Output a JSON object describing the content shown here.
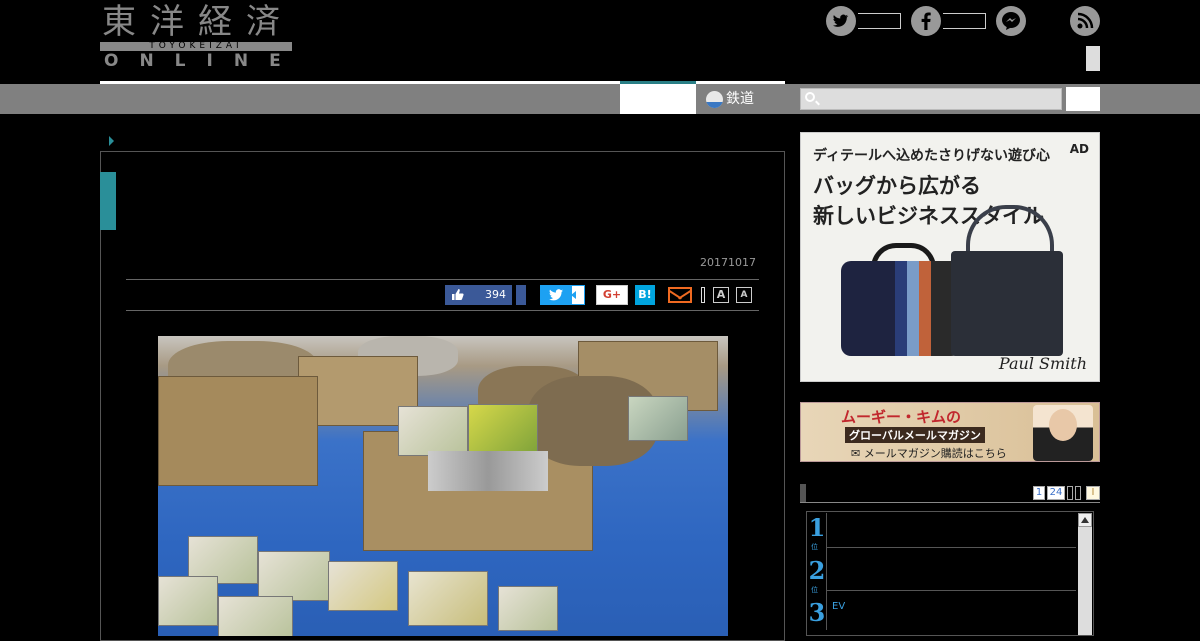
{
  "header": {
    "logo_kanji": "東洋経済",
    "logo_romaji": "TOYOKEIZAI",
    "logo_online": "ONLINE",
    "social": [
      {
        "name": "twitter-icon",
        "glyph": "🐦"
      },
      {
        "name": "facebook-icon",
        "glyph": "f"
      },
      {
        "name": "messenger-icon",
        "glyph": "⚡"
      }
    ]
  },
  "nav": {
    "railway_label": "鉄道",
    "search_placeholder": ""
  },
  "article": {
    "date": "20171017",
    "share": {
      "like_count": "394",
      "twitter_label": "🐦",
      "gplus_label": "G+",
      "hatena_label": "B!",
      "font_large": "A",
      "font_small": "A"
    }
  },
  "sidebar": {
    "ad": {
      "tagline": "ディテールへ込めたさりげない遊び心",
      "label": "AD",
      "headline_1": "バッグから広がる",
      "headline_2": "新しいビジネススタイル",
      "brand": "Paul Smith"
    },
    "mail_banner": {
      "title": "ムーギー・キムの",
      "subtitle": "グローバルメールマガジン",
      "cta": "✉ メールマガジン購読はこちら"
    },
    "ranking": {
      "tabs": [
        "1",
        "24",
        "",
        "",
        "I"
      ],
      "items": [
        {
          "rank": "1",
          "text": ""
        },
        {
          "rank": "2",
          "text": ""
        },
        {
          "rank": "3",
          "text": "EV"
        }
      ]
    }
  },
  "colors": {
    "accent_teal": "#2a8f99",
    "facebook": "#3b5998",
    "twitter": "#1da1f2",
    "hatena": "#00a4de",
    "mail": "#f06a21"
  }
}
